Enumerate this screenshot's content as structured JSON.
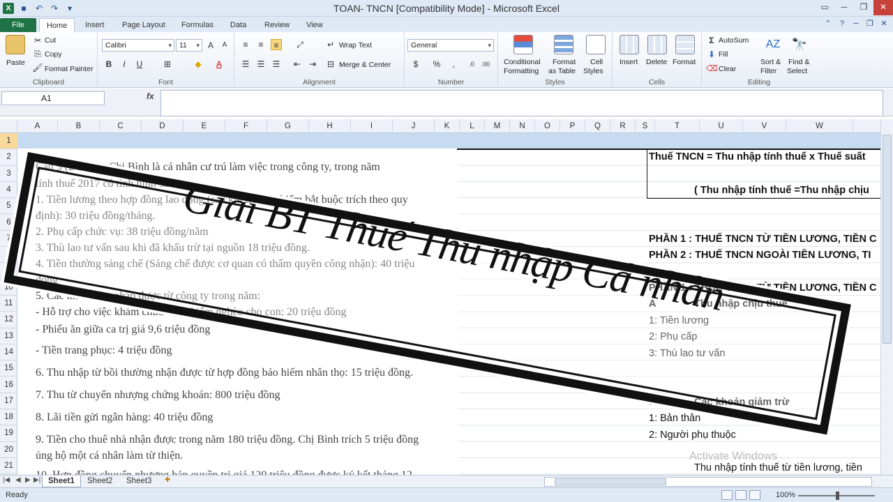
{
  "window": {
    "title": "TOAN- TNCN  [Compatibility Mode]  -  Microsoft Excel",
    "app_icon": "X"
  },
  "ribbon_tabs": [
    "File",
    "Home",
    "Insert",
    "Page Layout",
    "Formulas",
    "Data",
    "Review",
    "View"
  ],
  "ribbon": {
    "clipboard": {
      "paste": "Paste",
      "cut": "Cut",
      "copy": "Copy",
      "format_painter": "Format Painter",
      "label": "Clipboard"
    },
    "font": {
      "name": "Calibri",
      "size": "11",
      "label": "Font"
    },
    "alignment": {
      "wrap_text": "Wrap Text",
      "merge_center": "Merge & Center",
      "label": "Alignment"
    },
    "number": {
      "format": "General",
      "label": "Number"
    },
    "styles": {
      "conditional": "Conditional",
      "conditional2": "Formatting",
      "format_as": "Format",
      "format_as2": "as Table",
      "cell": "Cell",
      "cell2": "Styles",
      "label": "Styles"
    },
    "cells": {
      "insert": "Insert",
      "delete": "Delete",
      "format": "Format",
      "label": "Cells"
    },
    "editing": {
      "autosum": "AutoSum",
      "fill": "Fill",
      "clear": "Clear",
      "sort": "Sort &",
      "sort2": "Filter",
      "find": "Find &",
      "find2": "Select",
      "label": "Editing"
    }
  },
  "formula_bar": {
    "name_box": "A1",
    "fx": "fx",
    "value": ""
  },
  "columns": [
    "A",
    "B",
    "C",
    "D",
    "E",
    "F",
    "G",
    "H",
    "I",
    "J",
    "K",
    "L",
    "M",
    "N",
    "O",
    "P",
    "Q",
    "R",
    "S",
    "T",
    "U",
    "V",
    "W"
  ],
  "rows": [
    "1",
    "2",
    "3",
    "4",
    "5",
    "6",
    "7",
    "8",
    "9",
    "10",
    "11",
    "12",
    "13",
    "14",
    "15",
    "16",
    "17",
    "18",
    "19",
    "20",
    "21"
  ],
  "document_image_lines": [
    "Câu 5 (2 điểm): Chị Bình là cá nhân cư trú làm việc trong công ty, trong năm",
    "tính thuế 2017 có tình hình sau:",
    "1. Tiền lương theo hợp đồng lao động (sau khi trừ bảo hiểm bắt buộc trích theo quy",
    "định): 30 triệu đồng/tháng.",
    "2. Phụ cấp chức vụ: 38 triệu đồng/năm",
    "3. Thù lao tư vấn sau khi đã khấu trừ tại nguồn 18 triệu đồng.",
    "4. Tiền thưởng sáng chế (Sáng chế được cơ quan có thẩm quyền công nhận): 40 triệu",
    "đồng",
    "5. Các khoản thu nhập được từ công ty trong năm:",
    "- Hỗ trợ cho việc khám chữa bệnh hiểm nghèo cho con: 20 triệu đồng",
    "- Phiếu ăn giữa ca trị giá 9,6 triệu đồng",
    "- Tiền trang phục: 4 triệu đồng",
    "6. Thu nhập từ bồi thường nhận được từ hợp đồng bảo hiểm nhân thọ: 15 triệu đồng.",
    "7. Thu từ chuyển nhượng chứng khoán: 800 triệu đồng",
    "8. Lãi tiền gửi ngân hàng: 40 triệu đồng",
    "9. Tiền cho thuê nhà nhận được trong năm 180 triệu đồng. Chị Bình trích 5 triệu đồng",
    "ủng hộ một cá nhân làm từ thiện.",
    "10. Hợp đồng chuyển nhượng bản quyền trị giá 120 triệu đồng được ký kết tháng 12"
  ],
  "cells": {
    "formula_title": "Thuế TNCN =  Thu nhập tính thuế x Thuế suất",
    "formula_sub": "( Thu nhập tính thuế  =Thu nhập chịu",
    "part1": "PHẦN 1 : THUẾ TNCN TỪ TIỀN LƯƠNG, TIỀN C",
    "part2": "PHẦN 2 : THUẾ TNCN NGOÀI TIỀN LƯƠNG, TI",
    "part1b": "PHẦN 1 : THUẾ TNCN TỪ TIỀN LƯƠNG, TIỀN C",
    "a_label": "A",
    "a_title": "Thu nhập chịu thuế",
    "a1": "1: Tiền lương",
    "a2": "2: Phụ cấp",
    "a3": "3: Thù lao tư vấn",
    "b_label": "B",
    "b_title": "Các khoản giảm trừ",
    "b1": "1: Bản thân",
    "b2": "2: Người phụ thuộc",
    "bottom": "Thu nhập tính thuế từ tiền lương, tiền"
  },
  "banner_text": "Giải BT Thuế Thu nhập Cá nhân",
  "watermark": "Activate Windows",
  "sheet_tabs": [
    "Sheet1",
    "Sheet2",
    "Sheet3"
  ],
  "status": {
    "ready": "Ready",
    "zoom": "100%"
  },
  "colors": {
    "excel_green": "#1f7244",
    "row1_fill": "#c6dbf2",
    "banner": "#111111"
  }
}
